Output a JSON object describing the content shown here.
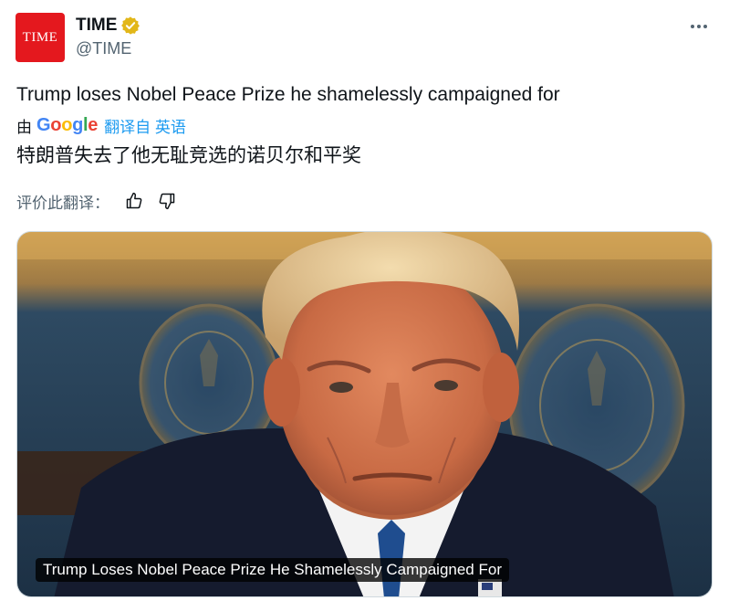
{
  "account": {
    "avatar_text": "TIME",
    "display_name": "TIME",
    "handle": "@TIME",
    "verified_icon": "verified-badge-gold"
  },
  "tweet": {
    "text_en": "Trump loses Nobel Peace Prize he shamelessly campaigned for",
    "translation": {
      "by_label": "由",
      "provider_letters": [
        "G",
        "o",
        "o",
        "g",
        "l",
        "e"
      ],
      "translated_from": "翻译自 英语",
      "text_zh": "特朗普失去了他无耻竞选的诺贝尔和平奖"
    },
    "rate": {
      "label": "评价此翻译：",
      "up_icon": "thumbs-up-icon",
      "down_icon": "thumbs-down-icon"
    }
  },
  "media": {
    "caption": "Trump Loses Nobel Peace Prize He Shamelessly Campaigned For"
  },
  "colors": {
    "time_red": "#e4181e",
    "link_blue": "#1d9bf0",
    "secondary_text": "#536471",
    "verified_gold": "#e2b719"
  }
}
